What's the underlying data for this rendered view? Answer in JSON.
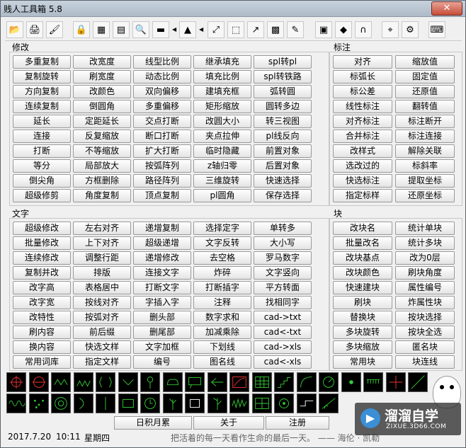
{
  "window": {
    "title": "贱人工具箱 5.8",
    "close_glyph": "✕"
  },
  "toolbar": {
    "icons": [
      "open-folder-icon",
      "print-icon",
      "paint-icon",
      "lock-icon",
      "image-icon",
      "document-icon",
      "zoom-icon",
      "measure-icon",
      "flag-icon",
      "explode-icon",
      "block-icon",
      "link-icon",
      "grid-icon",
      "pencil-icon",
      "device-icon",
      "eraser-icon",
      "magnet-icon",
      "pin-icon",
      "gear-icon",
      "keyboard-icon"
    ]
  },
  "sections": {
    "modify": {
      "label": "修改",
      "rows": [
        [
          "多重复制",
          "改宽度",
          "线型比例",
          "继承填充",
          "spl转pl"
        ],
        [
          "复制旋转",
          "刷宽度",
          "动态比例",
          "填充比例",
          "spl转铁路"
        ],
        [
          "方向复制",
          "改颜色",
          "双向偏移",
          "建填充框",
          "弧转圆"
        ],
        [
          "连续复制",
          "倒圆角",
          "多重偏移",
          "矩形缩放",
          "圆转多边"
        ],
        [
          "延长",
          "定距延长",
          "交点打断",
          "改圆大小",
          "转三视图"
        ],
        [
          "连接",
          "反复缩放",
          "断口打断",
          "夹点拉伸",
          "pl线反向"
        ],
        [
          "打断",
          "不等缩放",
          "扩大打断",
          "临时隐藏",
          "前置对象"
        ],
        [
          "等分",
          "局部放大",
          "按弧阵列",
          "z轴归零",
          "后置对象"
        ],
        [
          "倒尖角",
          "方框删除",
          "路径阵列",
          "三维旋转",
          "快速选择"
        ],
        [
          "超级修剪",
          "角度复制",
          "顶点复制",
          "pl圆角",
          "保存选择"
        ]
      ]
    },
    "dimension": {
      "label": "标注",
      "rows": [
        [
          "对齐",
          "缩放值"
        ],
        [
          "标弧长",
          "固定值"
        ],
        [
          "标公差",
          "还原值"
        ],
        [
          "线性标注",
          "翻转值"
        ],
        [
          "对齐标注",
          "标注断开"
        ],
        [
          "合并标注",
          "标注连接"
        ],
        [
          "改样式",
          "解除关联"
        ],
        [
          "选改过的",
          "标斜率"
        ],
        [
          "快选标注",
          "提取坐标"
        ],
        [
          "指定标样",
          "还原坐标"
        ]
      ]
    },
    "text": {
      "label": "文字",
      "rows": [
        [
          "超级修改",
          "左右对齐",
          "递增复制",
          "选择定字",
          "单转多"
        ],
        [
          "批量修改",
          "上下对齐",
          "超级递增",
          "文字反转",
          "大小写"
        ],
        [
          "连续修改",
          "调整行距",
          "递增修改",
          "去空格",
          "罗马数字"
        ],
        [
          "复制并改",
          "排版",
          "连接文字",
          "炸碎",
          "文字竖向"
        ],
        [
          "改字高",
          "表格居中",
          "打断文字",
          "打断插字",
          "平方转面"
        ],
        [
          "改字宽",
          "按线对齐",
          "字插入字",
          "注释",
          "找相同字"
        ],
        [
          "改特性",
          "按弧对齐",
          "删头部",
          "数字求和",
          "cad->txt"
        ],
        [
          "刷内容",
          "前后缀",
          "删尾部",
          "加减乘除",
          "cad<-txt"
        ],
        [
          "换内容",
          "快选文样",
          "文字加框",
          "下划线",
          "cad->xls"
        ],
        [
          "常用词库",
          "指定文样",
          "编号",
          "图名线",
          "cad<-xls"
        ]
      ]
    },
    "block": {
      "label": "块",
      "rows": [
        [
          "改块名",
          "统计单块"
        ],
        [
          "批量改名",
          "统计多块"
        ],
        [
          "改块基点",
          "改为0层"
        ],
        [
          "改块颜色",
          "刷块角度"
        ],
        [
          "快速建块",
          "属性编号"
        ],
        [
          "刷块",
          "炸属性块"
        ],
        [
          "替换块",
          "按块选择"
        ],
        [
          "多块旋转",
          "按块全选"
        ],
        [
          "多块缩放",
          "匿名块"
        ],
        [
          "常用块",
          "块连线"
        ]
      ]
    }
  },
  "palette": {
    "row1": [
      "crosshair-symbol-icon",
      "circle-target-symbol-icon",
      "zigzag-symbol-icon",
      "hatch-symbol-icon",
      "bracket-symbol-icon",
      "chevron-symbol-icon",
      "pin-symbol-icon",
      "cloud-symbol-icon",
      "speech-bubble-symbol-icon",
      "arrow-left-symbol-icon",
      "slope-symbol-icon",
      "table-symbol-icon",
      "stairs-symbol-icon",
      "curve-symbol-icon",
      "gauge-symbol-icon",
      "dot-symbol-icon",
      "comb-symbol-icon",
      "cross-symbol-icon",
      "diagonal-symbol-icon"
    ],
    "row2": [
      "wave-symbol-icon",
      "dots-symbol-icon",
      "concentric-circle-symbol-icon",
      "arc-symbol-icon",
      "line-symbol-icon",
      "rectangle-symbol-icon",
      "clock-symbol-icon",
      "tree-symbol-icon",
      "box-symbol-icon",
      "tree-branch-symbol-icon",
      "noise-symbol-icon",
      "grid-symbol-icon",
      "gear-symbol-icon",
      "step-line-symbol-icon",
      "rotation-symbol-icon"
    ]
  },
  "bottom": {
    "btn1": "日积月累",
    "btn2": "关于",
    "btn3": "注册",
    "date": "2017.7.20",
    "time": "10:11",
    "weekday": "星期四",
    "motto": "把活着的每一天看作生命的最后一天。  ——  海伦 · 凯勒"
  },
  "watermark": {
    "title": "溜溜自学",
    "url": "ZIXUE.3D66.COM",
    "logo_glyph": "▶"
  }
}
